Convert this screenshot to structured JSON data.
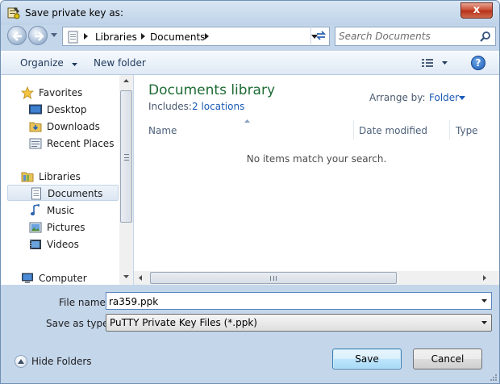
{
  "window": {
    "title": "Save private key as:",
    "close_glyph": "x"
  },
  "address": {
    "crumbs": [
      "Libraries",
      "Documents"
    ]
  },
  "search": {
    "placeholder": "Search Documents"
  },
  "toolbar": {
    "organize_label": "Organize",
    "new_folder_label": "New folder",
    "help_glyph": "?"
  },
  "nav": {
    "items": [
      {
        "label": "Favorites",
        "icon": "star-icon"
      },
      {
        "label": "Desktop",
        "icon": "desktop-icon"
      },
      {
        "label": "Downloads",
        "icon": "downloads-folder-icon"
      },
      {
        "label": "Recent Places",
        "icon": "recent-places-icon"
      },
      {
        "label": "Libraries",
        "icon": "libraries-icon"
      },
      {
        "label": "Documents",
        "icon": "documents-icon",
        "selected": true
      },
      {
        "label": "Music",
        "icon": "music-icon"
      },
      {
        "label": "Pictures",
        "icon": "pictures-icon"
      },
      {
        "label": "Videos",
        "icon": "videos-icon"
      },
      {
        "label": "Computer",
        "icon": "computer-icon"
      }
    ]
  },
  "content": {
    "library_title": "Documents library",
    "includes_label": "Includes:",
    "includes_link": "2 locations",
    "arrange_label": "Arrange by:",
    "arrange_value": "Folder",
    "columns": [
      "Name",
      "Date modified",
      "Type"
    ],
    "empty_message": "No items match your search."
  },
  "form": {
    "file_name_label": "File name:",
    "file_name_value": "ra359.ppk",
    "save_type_label": "Save as type:",
    "save_type_value": "PuTTY Private Key Files (*.ppk)"
  },
  "footer": {
    "hide_folders_label": "Hide Folders",
    "save_label": "Save",
    "cancel_label": "Cancel"
  },
  "colors": {
    "title_green": "#1e6b35",
    "link_blue": "#1a5bb5",
    "frame_blue": "#c4d6ea"
  }
}
